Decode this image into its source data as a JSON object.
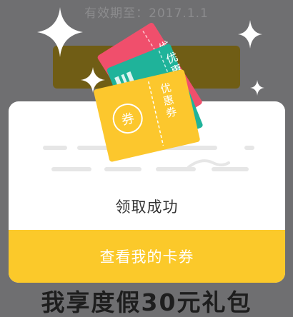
{
  "background": {
    "validity_text": "有效期至：2017.1.1",
    "bottom_text": "我享度假30元礼包"
  },
  "tickets": {
    "red_label": "优惠",
    "teal_label": "优惠",
    "yellow_label": "优惠券",
    "yellow_circle": "券"
  },
  "modal": {
    "success_text": "领取成功",
    "view_button_label": "查看我的卡券"
  },
  "colors": {
    "overlay": "#6f6f71",
    "accent_yellow": "#fbc92a",
    "ticket_red": "#f04f6c",
    "ticket_teal": "#1fb39a",
    "ticket_yellow": "#fcc72d"
  }
}
